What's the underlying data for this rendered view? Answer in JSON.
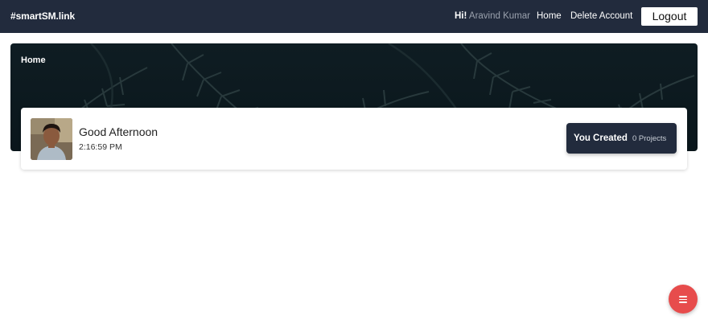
{
  "nav": {
    "brand": "#smartSM.link",
    "greeting_prefix": "Hi!",
    "user_name": "Aravind Kumar",
    "links": [
      "Home",
      "Delete Account"
    ],
    "logout_label": "Logout"
  },
  "hero": {
    "breadcrumb": "Home"
  },
  "welcome": {
    "greeting": "Good Afternoon",
    "time": "2:16:59 PM",
    "badge_label": "You Created",
    "badge_count": "0 Projects"
  },
  "fab": {
    "icon": "menu-icon"
  },
  "colors": {
    "navbar": "#222b3d",
    "fab": "#e74c4c",
    "badge": "#222b3d"
  }
}
